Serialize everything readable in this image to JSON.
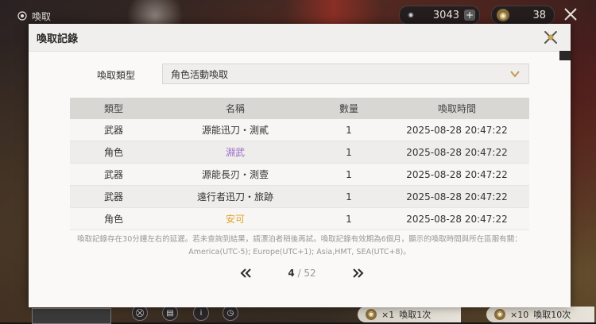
{
  "topbar": {
    "title": "喚取",
    "currency1_value": "3043",
    "currency1_plus": "+",
    "currency2_value": "38"
  },
  "dialog": {
    "title": "喚取記錄",
    "type_label": "喚取類型",
    "type_selected": "角色活動喚取",
    "table": {
      "headers": [
        "類型",
        "名稱",
        "數量",
        "喚取時間"
      ],
      "rows": [
        {
          "type": "武器",
          "name": "源能迅刀・測貳",
          "qty": "1",
          "time": "2025-08-28 20:47:22"
        },
        {
          "type": "角色",
          "name": "淵武",
          "qty": "1",
          "time": "2025-08-28 20:47:22"
        },
        {
          "type": "武器",
          "name": "源能長刃・測壹",
          "qty": "1",
          "time": "2025-08-28 20:47:22"
        },
        {
          "type": "武器",
          "name": "遠行者迅刀・旅跡",
          "qty": "1",
          "time": "2025-08-28 20:47:22"
        },
        {
          "type": "角色",
          "name": "安可",
          "qty": "1",
          "time": "2025-08-28 20:47:22"
        }
      ]
    },
    "note_line1": "喚取記錄存在30分鐘左右的延遲。若未查詢到結果，請漂泊者稍後再試。喚取記錄有效期為6個月，顯示的喚取時間與所在區服有關：",
    "note_line2": "America(UTC-5); Europe(UTC+1); Asia,HMT, SEA(UTC+8)。",
    "pager": {
      "current": "4",
      "separator": " / ",
      "total": "52"
    }
  },
  "bottom": {
    "pull1_count": "×1",
    "pull1_label": "喚取1次",
    "pull10_count": "×10",
    "pull10_label": "喚取10次"
  },
  "colors": {
    "rare4_purple": "#9d69c8",
    "rare5_gold": "#e0a52a"
  }
}
